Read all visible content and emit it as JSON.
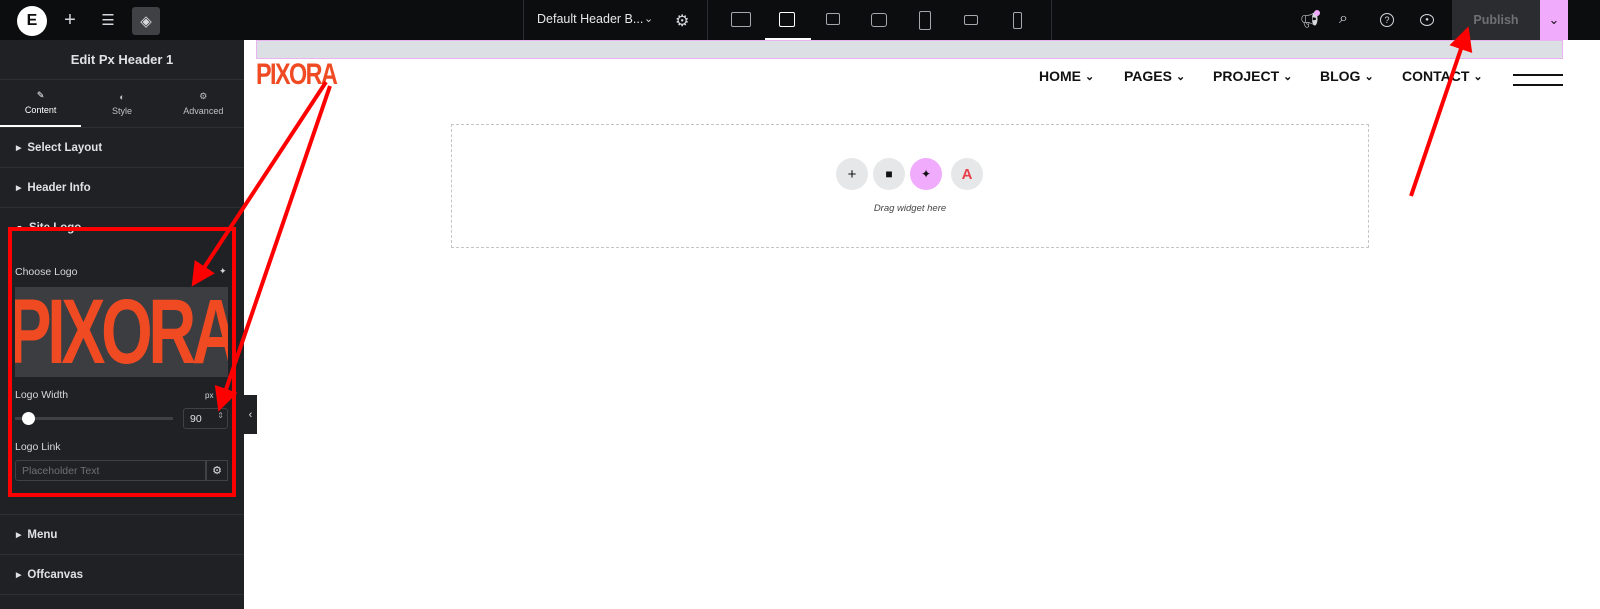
{
  "topbar": {
    "document_title": "Default Header B...",
    "publish_label": "Publish",
    "icons": [
      "elementor-logo-icon",
      "plus-icon",
      "sliders-icon",
      "layers-icon",
      "chevron-down-icon",
      "gear-icon",
      "desktop-icon",
      "laptop-wide-icon",
      "laptop-icon",
      "tablet-landscape-icon",
      "tablet-portrait-icon",
      "mobile-landscape-icon",
      "mobile-portrait-icon",
      "megaphone-icon",
      "search-icon",
      "help-icon",
      "eye-icon"
    ],
    "active_device": "laptop-wide",
    "accent": "#f0abfc"
  },
  "sidebar": {
    "title": "Edit Px Header 1",
    "tabs": [
      {
        "label": "Content",
        "active": true
      },
      {
        "label": "Style"
      },
      {
        "label": "Advanced"
      }
    ],
    "sections": {
      "select_layout": "Select Layout",
      "header_info": "Header Info",
      "site_logo": "Site Logo",
      "menu": "Menu",
      "offcanvas": "Offcanvas"
    },
    "site_logo": {
      "choose_logo": "Choose Logo",
      "logo_text": "PIXORA",
      "logo_width_label": "Logo Width",
      "unit": "px",
      "logo_width_value": "90",
      "logo_link_label": "Logo Link",
      "logo_link_placeholder": "Placeholder Text"
    }
  },
  "canvas": {
    "logo_text": "PIXORA",
    "brand_color": "#f04a23",
    "nav": [
      "HOME",
      "PAGES",
      "PROJECT",
      "BLOG",
      "CONTACT"
    ],
    "drop_text": "Drag widget here"
  },
  "annotation_color": "#ff0000"
}
